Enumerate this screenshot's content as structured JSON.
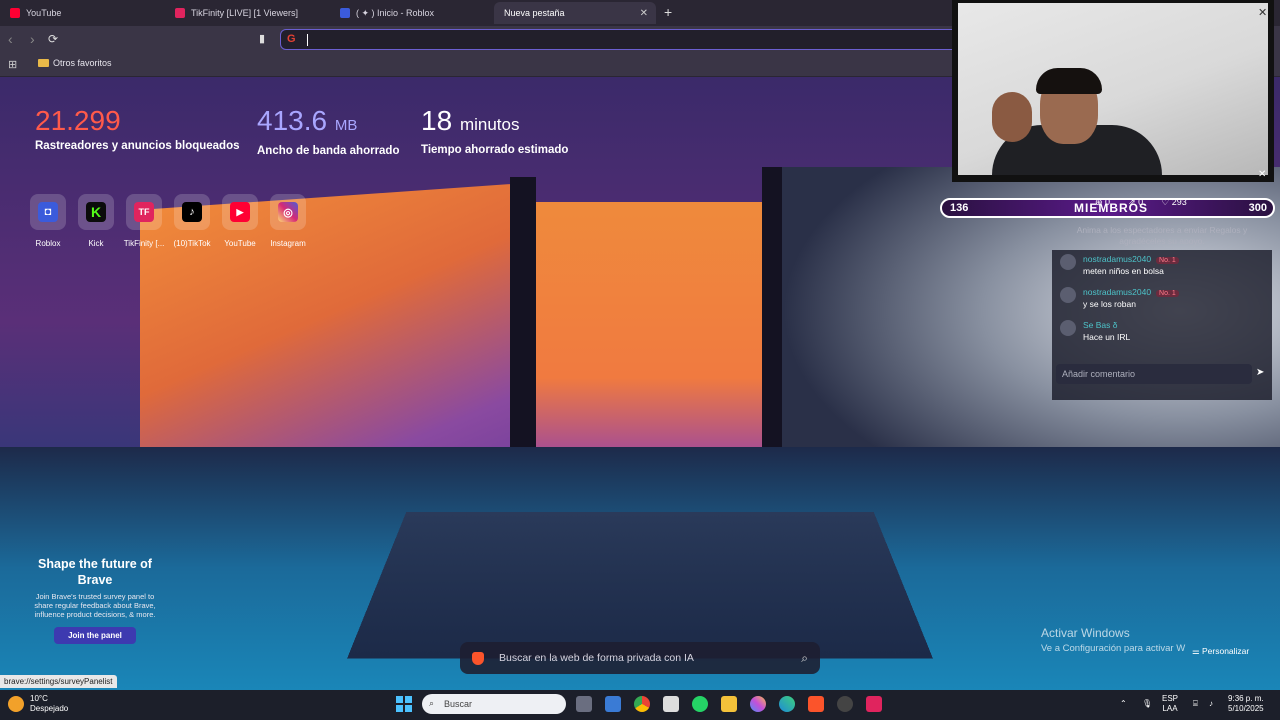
{
  "tabs": [
    {
      "title": "YouTube",
      "color": "#ff0033"
    },
    {
      "title": "TikFinity [LIVE] [1 Viewers]",
      "color": "#e0245e"
    },
    {
      "title": "( ✦ ) Inicio - Roblox",
      "color": "#3b5bdb"
    },
    {
      "title": "Nueva pestaña",
      "active": true
    }
  ],
  "bookmarks": {
    "folder": "Otros favoritos"
  },
  "stats": {
    "trackers_value": "21.299",
    "trackers_label": "Rastreadores y anuncios bloqueados",
    "bandwidth_value": "413.6",
    "bandwidth_unit": "MB",
    "bandwidth_label": "Ancho de banda ahorrado",
    "time_value": "18",
    "time_unit": "minutos",
    "time_label": "Tiempo ahorrado estimado"
  },
  "top_sites": [
    {
      "name": "Roblox",
      "icon": "roblox-icon",
      "color": "#3b5bdb"
    },
    {
      "name": "Kick",
      "icon": "kick-icon",
      "color": "#0b0b0b"
    },
    {
      "name": "TikFinity [...",
      "icon": "tikfinity-icon",
      "color": "#e0245e"
    },
    {
      "name": "(10)TikTok",
      "icon": "tiktok-icon",
      "color": "#000000"
    },
    {
      "name": "YouTube",
      "icon": "youtube-icon",
      "color": "#ff0033"
    },
    {
      "name": "Instagram",
      "icon": "instagram-icon",
      "color": "#d62976"
    }
  ],
  "promo": {
    "title": "Shape the future of Brave",
    "body": "Join Brave's trusted survey panel to share regular feedback about Brave, influence product decisions, & more.",
    "button": "Join the panel"
  },
  "status_url": "brave://settings/surveyPanelist",
  "search": {
    "placeholder": "Buscar en la web de forma privada con IA"
  },
  "watermark": {
    "line1": "Activar Windows",
    "line2": "Ve a Configuración para activar W"
  },
  "personalize": "Personalizar",
  "tikfinity": {
    "left_count": "136",
    "title": "MIEMBROS",
    "right_count": "300",
    "stat_follows": "0",
    "stat_shares": "0",
    "stat_likes": "293",
    "hint": "Anima a los espectadores a enviar Regalos y agradéceles su apoyo.",
    "messages": [
      {
        "user": "nostradamus2040",
        "badge": "No. 1",
        "text": "meten niños en bolsa"
      },
      {
        "user": "nostradamus2040",
        "badge": "No. 1",
        "text": "y se los roban"
      },
      {
        "user": "Se Bas δ",
        "badge": "",
        "text": "Hace un IRL"
      }
    ],
    "input_placeholder": "Añadir comentario"
  },
  "taskbar": {
    "temp": "10°C",
    "weather": "Despejado",
    "search": "Buscar",
    "lang1": "ESP",
    "lang2": "LAA",
    "time": "9:36 p. m.",
    "date": "5/10/2025"
  }
}
